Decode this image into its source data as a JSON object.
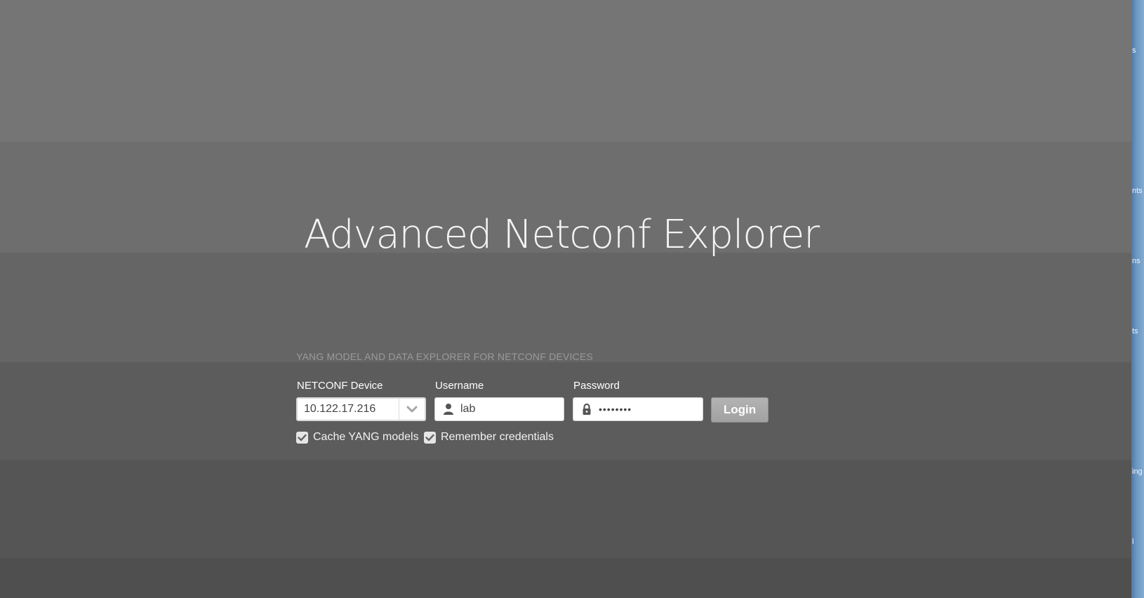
{
  "app": {
    "title": "Advanced Netconf Explorer",
    "subtitle": "YANG MODEL AND DATA EXPLORER FOR NETCONF DEVICES"
  },
  "form": {
    "device": {
      "label": "NETCONF Device",
      "value": "10.122.17.216",
      "icon": "chevron-down-icon"
    },
    "username": {
      "label": "Username",
      "value": "lab",
      "icon": "user-icon"
    },
    "password": {
      "label": "Password",
      "value": "••••••••",
      "icon": "lock-icon"
    },
    "login_label": "Login",
    "cache_label": "Cache YANG models",
    "cache_checked": true,
    "remember_label": "Remember credentials",
    "remember_checked": true
  },
  "right_edge": {
    "fragments": [
      "s",
      "nts",
      "ns",
      "ts",
      "ing",
      "l"
    ]
  },
  "colors": {
    "background": "#656565",
    "title_text": "#f4f4f4",
    "subtitle_text": "#9a9a9a",
    "login_button": "#a8a8a8",
    "edge_blue": "#6b97c2"
  }
}
